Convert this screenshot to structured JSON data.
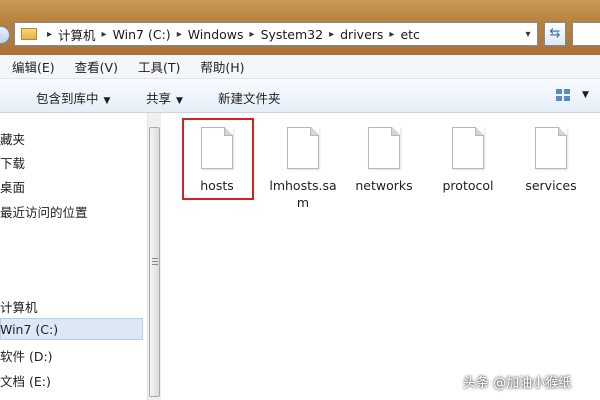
{
  "address": {
    "breadcrumb": [
      "计算机",
      "Win7 (C:)",
      "Windows",
      "System32",
      "drivers",
      "etc"
    ],
    "refresh_icon": "refresh-icon"
  },
  "menu": [
    "编辑(E)",
    "查看(V)",
    "工具(T)",
    "帮助(H)"
  ],
  "toolbar": {
    "include_library": "包含到库中",
    "share": "共享",
    "new_folder": "新建文件夹"
  },
  "sidebar": {
    "items": [
      "藏夹",
      "下载",
      "桌面",
      "最近访问的位置",
      "计算机",
      "Win7 (C:)",
      "软件 (D:)",
      "文档 (E:)"
    ],
    "selected": "Win7 (C:)"
  },
  "files": [
    {
      "name": "hosts",
      "highlighted": true
    },
    {
      "name": "lmhosts.sam",
      "highlighted": false
    },
    {
      "name": "networks",
      "highlighted": false
    },
    {
      "name": "protocol",
      "highlighted": false
    },
    {
      "name": "services",
      "highlighted": false
    }
  ],
  "watermark": "头条 @加油小猴纸",
  "colors": {
    "highlight_border": "#d62020",
    "selection": "#dde8f6"
  }
}
